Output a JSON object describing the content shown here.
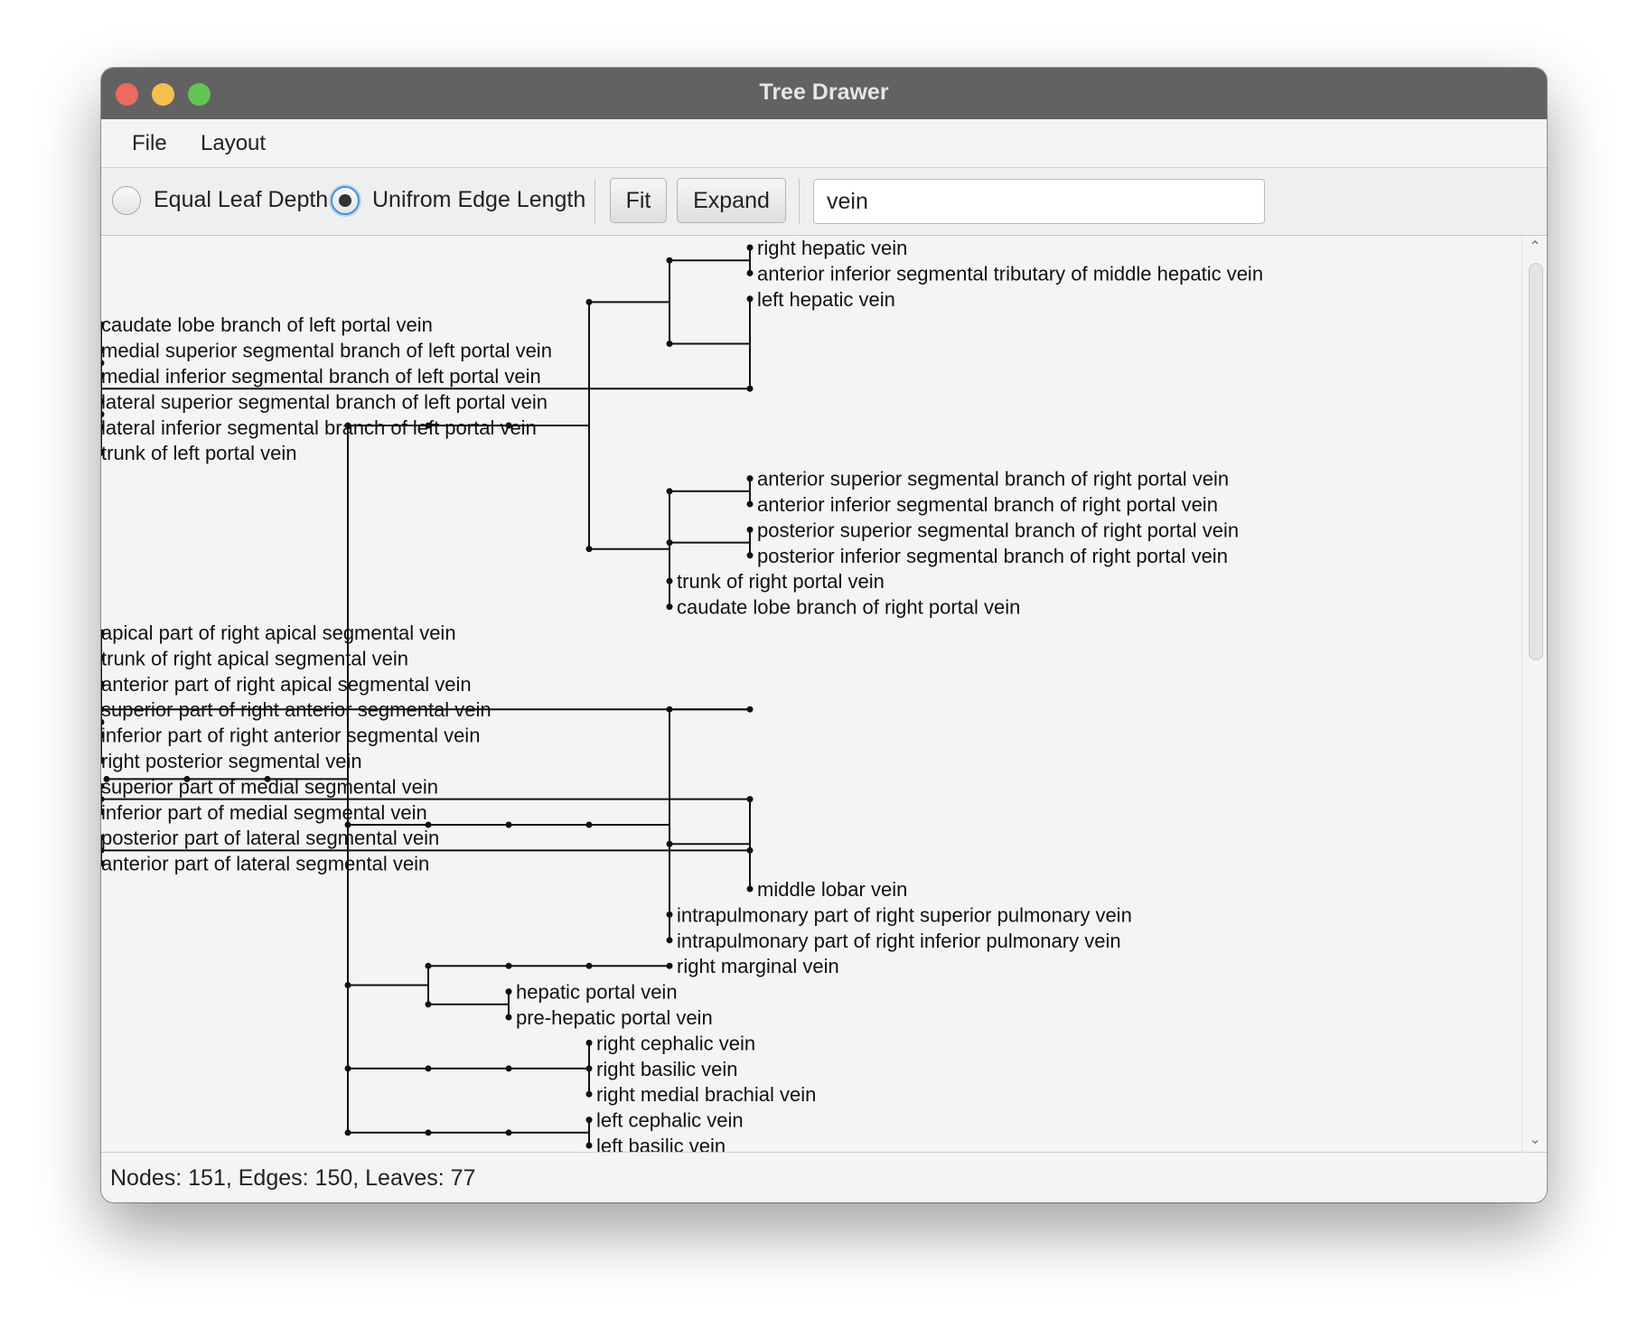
{
  "window": {
    "title": "Tree Drawer"
  },
  "menu": {
    "file": "File",
    "layout": "Layout"
  },
  "toolbar": {
    "equal_leaf_depth": "Equal Leaf Depth",
    "uniform_edge_length": "Unifrom Edge Length",
    "fit": "Fit",
    "expand": "Expand",
    "search_value": "vein"
  },
  "status": "Nodes: 151, Edges: 150, Leaves: 77",
  "tree": {
    "leaves": [
      "right hepatic vein",
      "anterior inferior segmental tributary of middle hepatic vein",
      "left hepatic vein",
      "caudate lobe branch of left portal vein",
      "medial superior segmental branch of left portal vein",
      "medial inferior segmental branch of left portal vein",
      "lateral superior segmental branch of left portal vein",
      "lateral inferior segmental branch of left portal vein",
      "trunk of left portal vein",
      "anterior superior segmental branch of right portal vein",
      "anterior inferior segmental branch of right portal vein",
      "posterior superior segmental branch of right portal vein",
      "posterior inferior segmental branch of right portal vein",
      "trunk of right portal vein",
      "caudate lobe branch of right portal vein",
      "apical part of right apical segmental vein",
      "trunk of right apical segmental vein",
      "anterior part of right apical segmental vein",
      "superior part of right anterior segmental vein",
      "inferior part of right anterior segmental vein",
      "right posterior segmental vein",
      "superior part of medial segmental vein",
      "inferior part of medial segmental vein",
      "posterior part of lateral segmental vein",
      "anterior part of lateral segmental vein",
      "middle lobar vein",
      "intrapulmonary part of right superior pulmonary vein",
      "intrapulmonary part of right inferior pulmonary vein",
      "right marginal vein",
      "hepatic portal vein",
      "pre-hepatic portal vein",
      "right cephalic vein",
      "right basilic vein",
      "right medial brachial vein",
      "left cephalic vein",
      "left basilic vein"
    ]
  }
}
